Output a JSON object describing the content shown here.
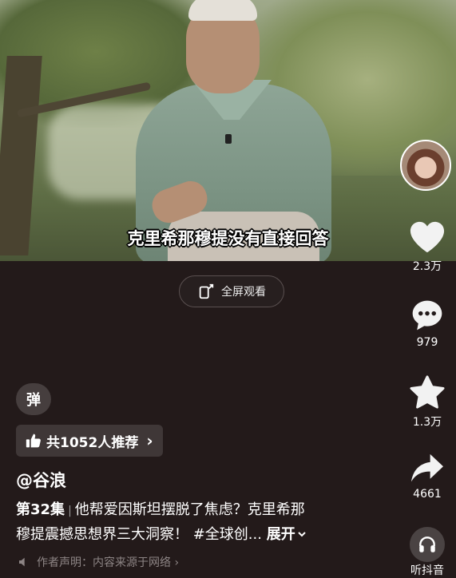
{
  "video": {
    "subtitle": "克里希那穆提没有直接回答"
  },
  "fullscreen": {
    "label": "全屏观看",
    "icon": "fullscreen-icon"
  },
  "rail": {
    "like_count": "2.3万",
    "comment_count": "979",
    "favorite_count": "1.3万",
    "share_count": "4661",
    "listen_label": "听抖音"
  },
  "danmu": {
    "label": "弹"
  },
  "recommend": {
    "label": "共1052人推荐",
    "chevron": "›"
  },
  "post": {
    "author": "@谷浪",
    "episode": "第32集",
    "separator": "|",
    "text_line1": "他帮爱因斯坦摆脱了焦虑？克里希那",
    "text_line2": "穆提震撼思想界三大洞察！ #全球创...",
    "expand": "展开",
    "statement": "作者声明：内容来源于网络 ›"
  },
  "colors": {
    "background": "#231a1a",
    "text": "#ffffff",
    "muted": "#8d8585"
  }
}
